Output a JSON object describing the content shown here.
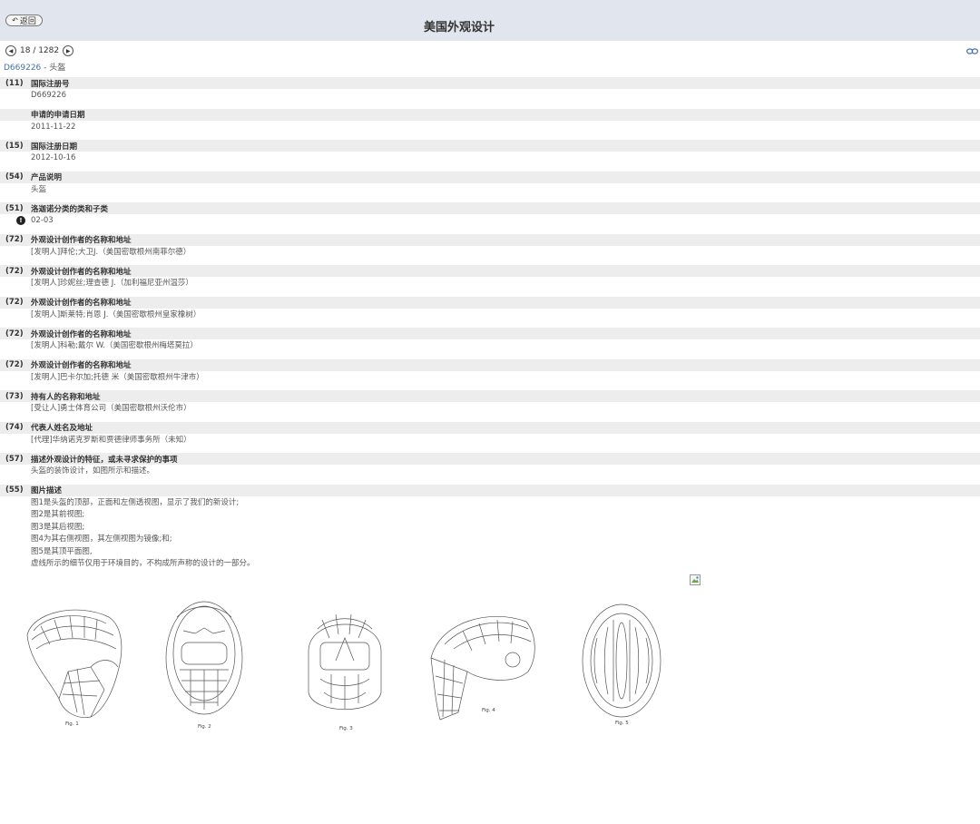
{
  "header": {
    "back_label": "返回",
    "title": "美国外观设计"
  },
  "pager": {
    "text": "18 / 1282"
  },
  "crumb": {
    "number": "D669226",
    "sep": " - ",
    "name": "头盔"
  },
  "fields": [
    {
      "code": "(11)",
      "label": "国际注册号",
      "lines": [
        "D669226"
      ]
    },
    {
      "code": "",
      "label": "申请的申请日期",
      "lines": [
        "2011-11-22"
      ]
    },
    {
      "code": "(15)",
      "label": "国际注册日期",
      "lines": [
        "2012-10-16"
      ]
    },
    {
      "code": "(54)",
      "label": "产品说明",
      "lines": [
        "头盔"
      ]
    },
    {
      "code": "(51)",
      "label": "洛迦诺分类的类和子类",
      "lines": [
        "02-03"
      ]
    },
    {
      "code": "(72)",
      "label": "外观设计创作者的名称和地址",
      "lines": [
        "[发明人]拜伦;大卫J.（美国密歇根州南菲尔德）"
      ]
    },
    {
      "code": "(72)",
      "label": "外观设计创作者的名称和地址",
      "lines": [
        "[发明人]珍妮丝;理查德 J.（加利福尼亚州温莎）"
      ]
    },
    {
      "code": "(72)",
      "label": "外观设计创作者的名称和地址",
      "lines": [
        "[发明人]斯莱特;肖恩 J.（美国密歇根州皇家橡树）"
      ]
    },
    {
      "code": "(72)",
      "label": "外观设计创作者的名称和地址",
      "lines": [
        "[发明人]科勒;戴尔 W.（美国密歇根州梅塔莫拉）"
      ]
    },
    {
      "code": "(72)",
      "label": "外观设计创作者的名称和地址",
      "lines": [
        "[发明人]巴卡尔加;托德 米（美国密歇根州牛津市）"
      ]
    },
    {
      "code": "(73)",
      "label": "持有人的名称和地址",
      "lines": [
        "[受让人]勇士体育公司（美国密歇根州沃伦市）"
      ]
    },
    {
      "code": "(74)",
      "label": "代表人姓名及地址",
      "lines": [
        "[代理]华纳诺克罗斯和贾德律师事务所（未知）"
      ]
    },
    {
      "code": "(57)",
      "label": "描述外观设计的特征，或未寻求保护的事项",
      "lines": [
        "头盔的装饰设计，如图所示和描述。"
      ]
    },
    {
      "code": "(55)",
      "label": "图片描述",
      "lines": [
        "图1是头盔的顶部，正面和左侧透视图，显示了我们的新设计;",
        "图2是其前视图;",
        "图3是其后视图;",
        "图4为其右侧视图，其左侧视图为镜像;和;",
        "图5是其顶平面图,",
        "虚线所示的细节仅用于环境目的，不构成所声称的设计的一部分。"
      ]
    }
  ],
  "figures": [
    {
      "caption": "Fig. 1"
    },
    {
      "caption": "Fig. 2"
    },
    {
      "caption": "Fig. 3"
    },
    {
      "caption": "Fig. 4"
    },
    {
      "caption": "Fig. 5"
    }
  ]
}
